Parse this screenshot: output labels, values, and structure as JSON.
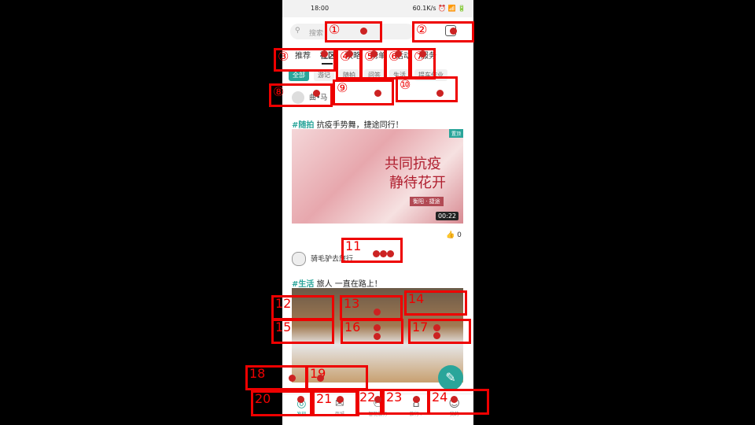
{
  "status": {
    "time": "18:00",
    "right": "60.1K/s ⏰ 📶 🔋"
  },
  "search": {
    "placeholder": "搜索",
    "icon": "search-icon"
  },
  "tabs": [
    {
      "label": "推荐"
    },
    {
      "label": "社区"
    },
    {
      "label": "攻略"
    },
    {
      "label": "榜单"
    },
    {
      "label": "活动"
    },
    {
      "label": "服务"
    }
  ],
  "chips": [
    "全部",
    "游记",
    "随拍",
    "问答",
    "生活",
    "提车作业"
  ],
  "feed": {
    "user1": "曲•马",
    "post1": {
      "tag": "#随拍",
      "title": "抗疫手势舞，捷途同行！",
      "art_line1": "共同抗疫",
      "art_line2": "静待花开",
      "art_line3": "衡阳 · 捷途",
      "badge": "置顶",
      "duration": "00:22",
      "likes": "0"
    },
    "user2": "骑毛驴去旅行",
    "post2": {
      "tag": "#生活",
      "title": "旅人 一直在路上！"
    }
  },
  "bottom_nav": [
    {
      "label": "发现",
      "icon": "discover-icon",
      "glyph": "◎",
      "active": true
    },
    {
      "label": "商城",
      "icon": "mall-icon",
      "glyph": "✉"
    },
    {
      "label": "智能服务",
      "icon": "service-icon",
      "glyph": "⚇"
    },
    {
      "label": "旅行+",
      "icon": "travel-icon",
      "glyph": "⌂"
    },
    {
      "label": "我的",
      "icon": "profile-icon",
      "glyph": "☺"
    }
  ],
  "fab_glyph": "✎",
  "marks": [
    "①",
    "②",
    "③",
    "④",
    "⑤",
    "⑥",
    "⑦",
    "⑧",
    "⑨",
    "⑩",
    "11",
    "12",
    "13",
    "14",
    "15",
    "16",
    "17",
    "18",
    "19",
    "20",
    "21",
    "22",
    "23",
    "24"
  ]
}
